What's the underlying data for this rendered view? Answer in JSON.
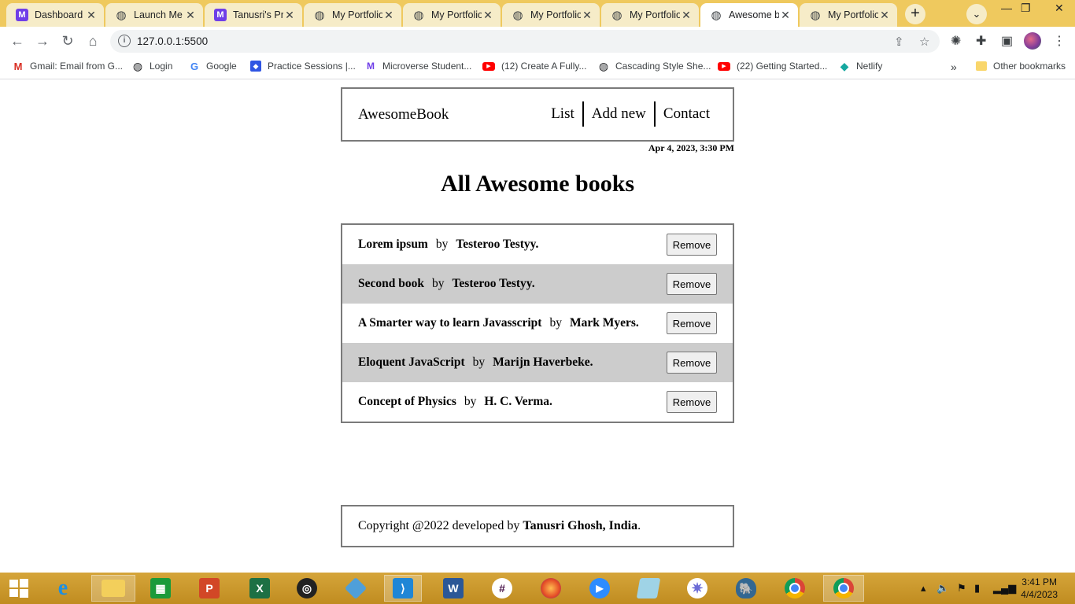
{
  "browser": {
    "tabs": [
      {
        "title": "Dashboard",
        "icon": "microverse-icon",
        "active": false
      },
      {
        "title": "Launch Me",
        "icon": "globe-icon",
        "active": false
      },
      {
        "title": "Tanusri's Pr",
        "icon": "microverse-icon",
        "active": false
      },
      {
        "title": "My Portfolio",
        "icon": "globe-icon",
        "active": false
      },
      {
        "title": "My Portfolio",
        "icon": "globe-icon",
        "active": false
      },
      {
        "title": "My Portfolio",
        "icon": "globe-icon",
        "active": false
      },
      {
        "title": "My Portfolio",
        "icon": "globe-icon",
        "active": false
      },
      {
        "title": "Awesome b",
        "icon": "globe-icon",
        "active": true
      },
      {
        "title": "My Portfolio",
        "icon": "globe-icon",
        "active": false
      }
    ],
    "url": "127.0.0.1:5500",
    "bookmarks": [
      {
        "label": "Gmail: Email from G...",
        "icon": "gmail-icon"
      },
      {
        "label": "Login",
        "icon": "globe-icon"
      },
      {
        "label": "Google",
        "icon": "google-icon"
      },
      {
        "label": "Practice Sessions |...",
        "icon": "practice-icon"
      },
      {
        "label": "Microverse Student...",
        "icon": "microverse-icon"
      },
      {
        "label": "(12) Create A Fully...",
        "icon": "youtube-icon"
      },
      {
        "label": "Cascading Style She...",
        "icon": "globe-icon"
      },
      {
        "label": "(22) Getting Started...",
        "icon": "youtube-icon"
      },
      {
        "label": "Netlify",
        "icon": "netlify-icon"
      }
    ],
    "other_bookmarks": "Other bookmarks",
    "colors": {
      "tabstrip": "#efc95e",
      "active_tab": "#ffffff"
    }
  },
  "app": {
    "brand": "AwesomeBook",
    "nav": {
      "list": "List",
      "add_new": "Add new",
      "contact": "Contact"
    },
    "datetime": "Apr 4, 2023, 3:30 PM",
    "heading": "All Awesome books",
    "by_label": "by",
    "remove_label": "Remove",
    "books": [
      {
        "title": "Lorem ipsum",
        "author": "Testeroo Testyy."
      },
      {
        "title": "Second book",
        "author": "Testeroo Testyy."
      },
      {
        "title": "A Smarter way to learn Javasscript",
        "author": "Mark Myers."
      },
      {
        "title": "Eloquent JavaScript",
        "author": "Marijn Haverbeke."
      },
      {
        "title": "Concept of Physics",
        "author": "H. C. Verma."
      }
    ],
    "footer": {
      "prefix": "Copyright @2022 developed by ",
      "author": "Tanusri Ghosh, India",
      "suffix": "."
    }
  },
  "taskbar": {
    "time": "3:41 PM",
    "date": "4/4/2023"
  }
}
